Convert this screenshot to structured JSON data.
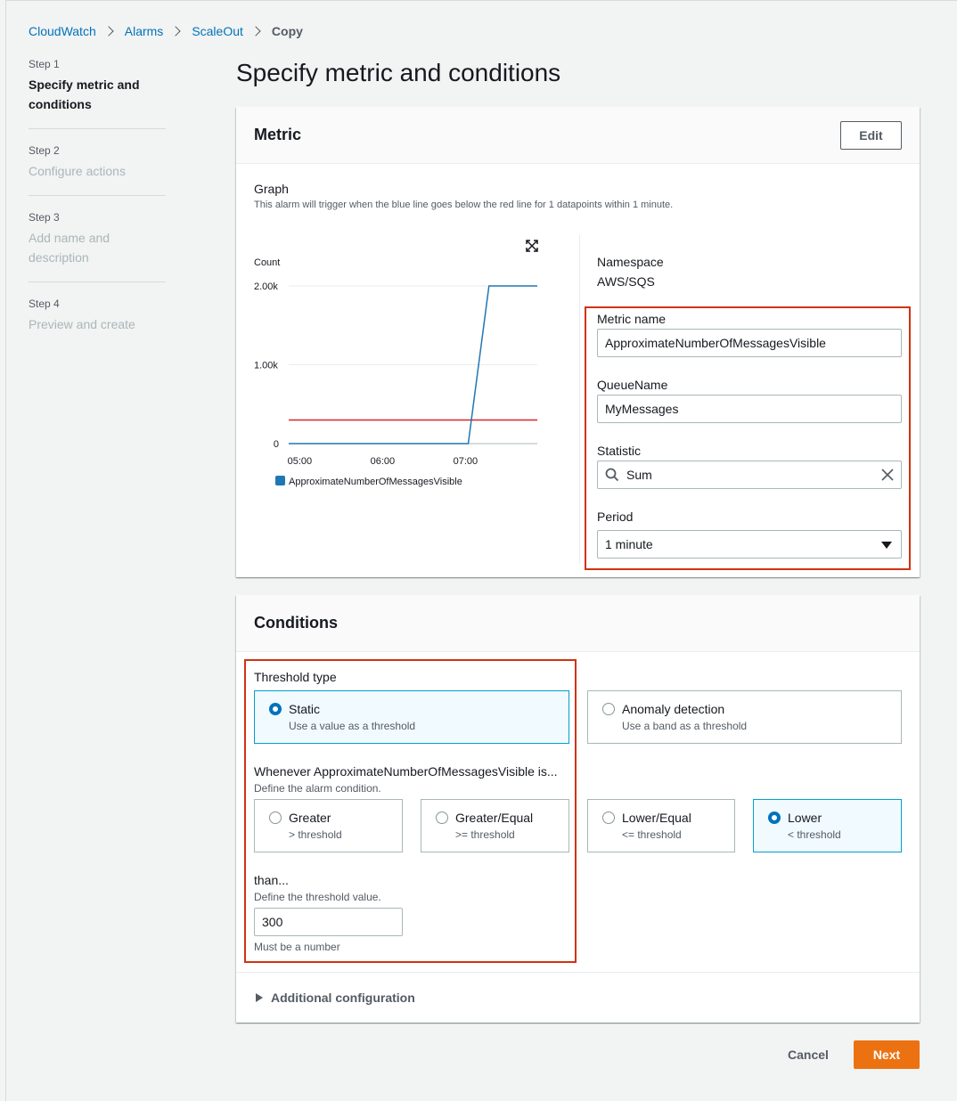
{
  "breadcrumb": {
    "items": [
      "CloudWatch",
      "Alarms",
      "ScaleOut"
    ],
    "current": "Copy"
  },
  "steps": [
    {
      "num": "Step 1",
      "title": "Specify metric and conditions"
    },
    {
      "num": "Step 2",
      "title": "Configure actions"
    },
    {
      "num": "Step 3",
      "title": "Add name and description"
    },
    {
      "num": "Step 4",
      "title": "Preview and create"
    }
  ],
  "page_title": "Specify metric and conditions",
  "metric": {
    "title": "Metric",
    "edit_label": "Edit",
    "graph_label": "Graph",
    "graph_desc": "This alarm will trigger when the blue line goes below the red line for 1 datapoints within 1 minute.",
    "namespace_label": "Namespace",
    "namespace_value": "AWS/SQS",
    "metric_name_label": "Metric name",
    "metric_name_value": "ApproximateNumberOfMessagesVisible",
    "queue_label": "QueueName",
    "queue_value": "MyMessages",
    "statistic_label": "Statistic",
    "statistic_value": "Sum",
    "period_label": "Period",
    "period_value": "1 minute"
  },
  "chart_data": {
    "type": "line",
    "ylabel": "Count",
    "y_ticks": [
      "2.00k",
      "1.00k",
      "0"
    ],
    "x_ticks": [
      "05:00",
      "06:00",
      "07:00"
    ],
    "ylim": [
      0,
      2000
    ],
    "series": [
      {
        "name": "ApproximateNumberOfMessagesVisible",
        "color": "#1f77b4",
        "x": [
          "04:52",
          "07:02",
          "07:17",
          "07:52"
        ],
        "values": [
          0,
          0,
          2000,
          2000
        ]
      }
    ],
    "threshold": {
      "value": 300,
      "color": "#d62728"
    },
    "legend": [
      "ApproximateNumberOfMessagesVisible"
    ]
  },
  "conditions": {
    "title": "Conditions",
    "threshold_type_label": "Threshold type",
    "static_title": "Static",
    "static_desc": "Use a value as a threshold",
    "anomaly_title": "Anomaly detection",
    "anomaly_desc": "Use a band as a threshold",
    "whenever_label": "Whenever ApproximateNumberOfMessagesVisible is...",
    "whenever_desc": "Define the alarm condition.",
    "greater_title": "Greater",
    "greater_desc": "> threshold",
    "greater_eq_title": "Greater/Equal",
    "greater_eq_desc": ">= threshold",
    "lower_eq_title": "Lower/Equal",
    "lower_eq_desc": "<= threshold",
    "lower_title": "Lower",
    "lower_desc": "< threshold",
    "than_label": "than...",
    "than_desc": "Define the threshold value.",
    "threshold_value": "300",
    "threshold_hint": "Must be a number",
    "additional_label": "Additional configuration"
  },
  "footer": {
    "cancel_label": "Cancel",
    "next_label": "Next"
  },
  "colors": {
    "link": "#0073bb",
    "primary": "#ec7211",
    "highlight": "#d13212",
    "selected_border": "#00a1c9"
  }
}
